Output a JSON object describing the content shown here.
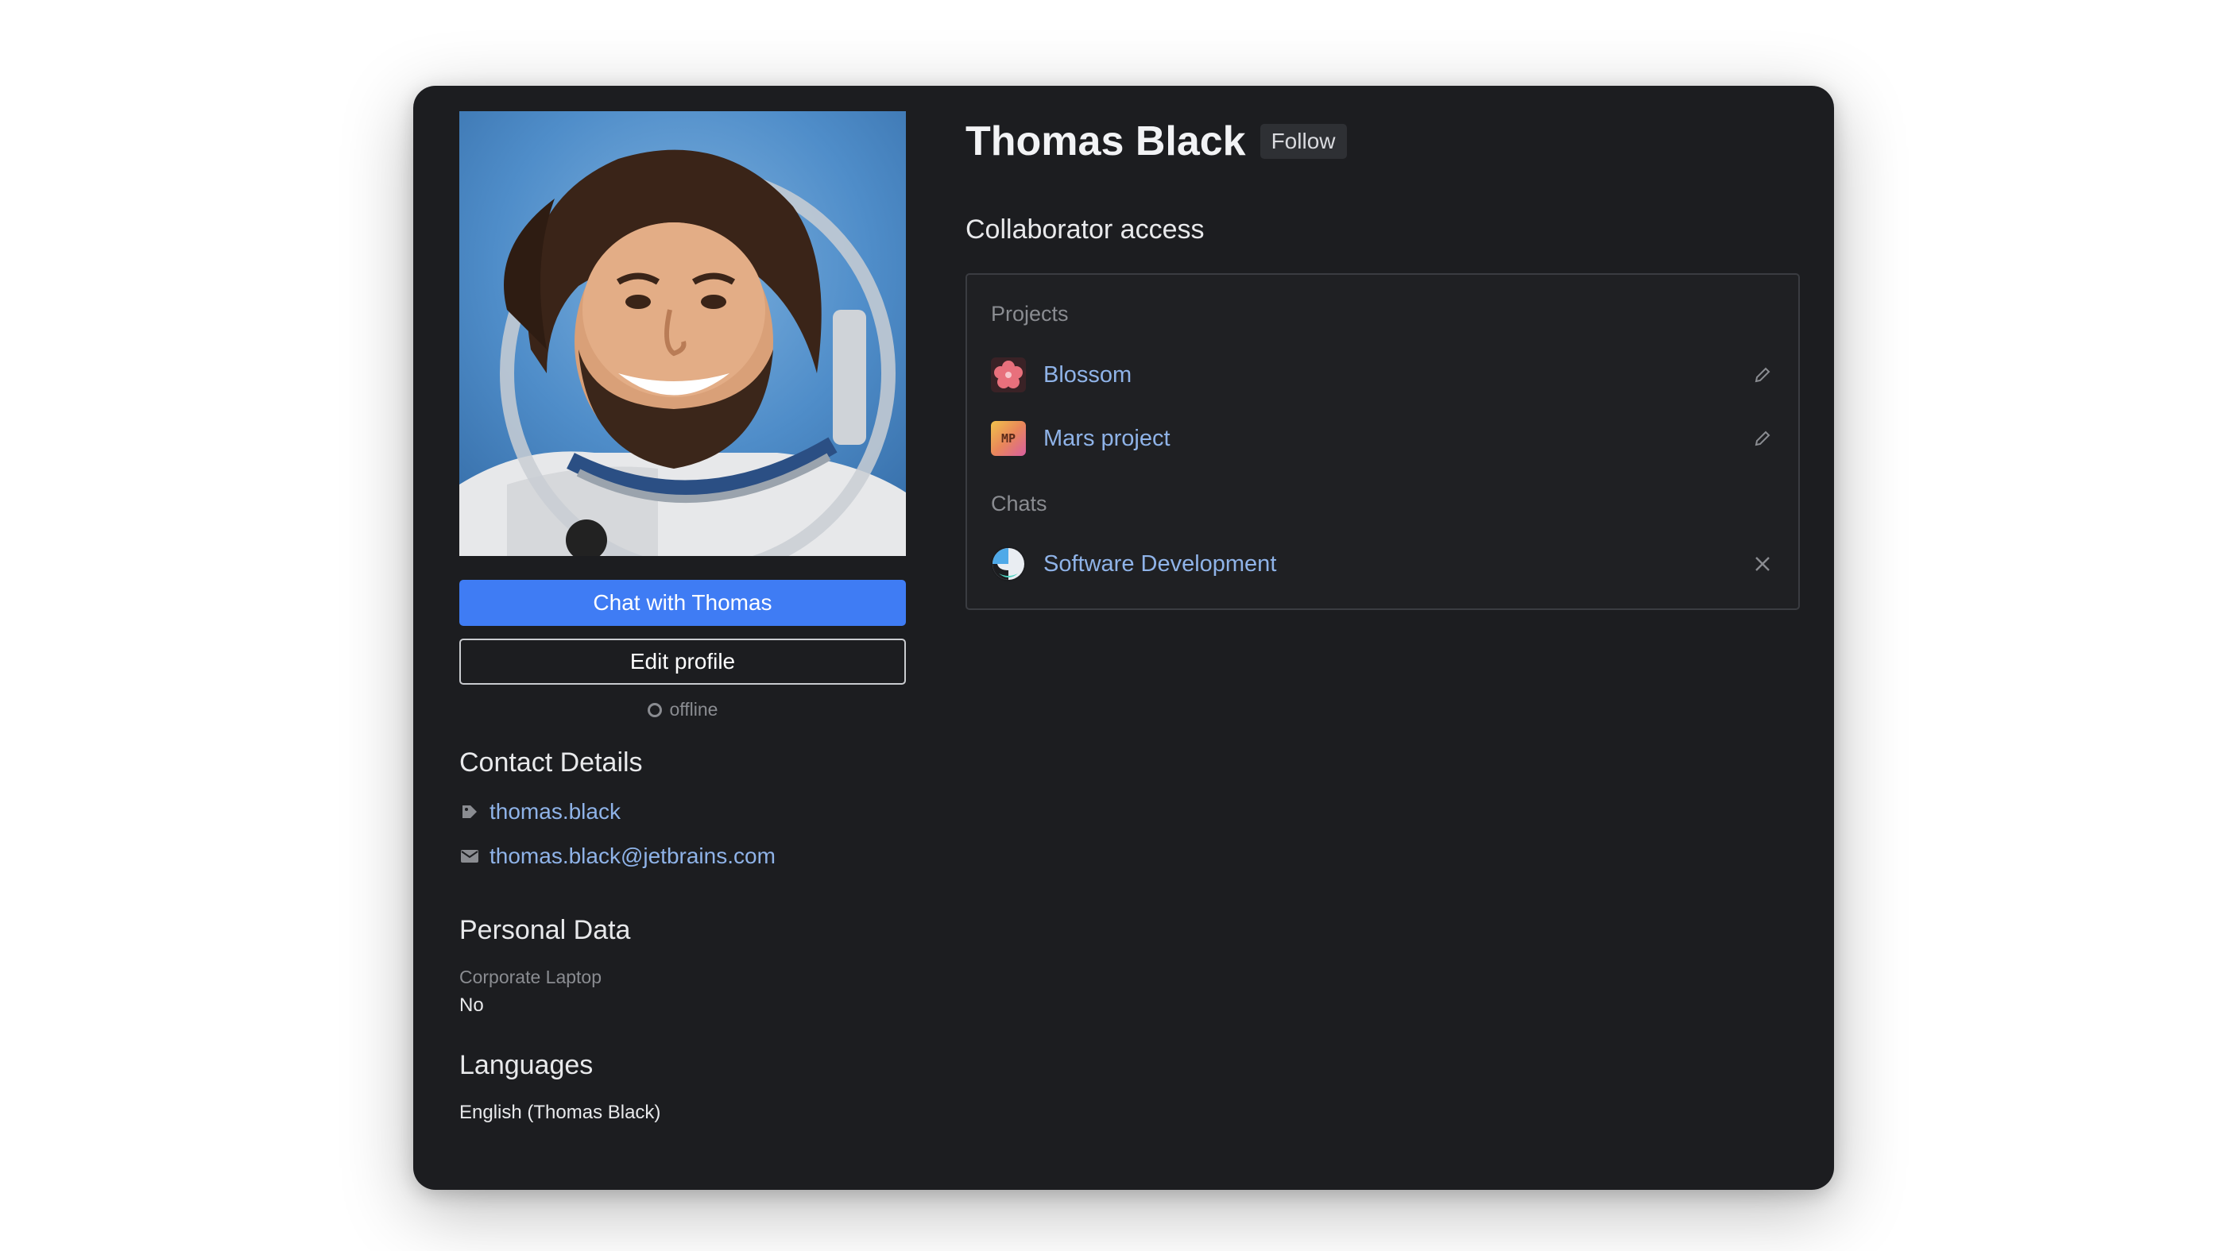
{
  "profile": {
    "name": "Thomas Black",
    "follow_label": "Follow",
    "chat_button": "Chat with Thomas",
    "edit_button": "Edit profile",
    "status": "offline"
  },
  "contact": {
    "title": "Contact Details",
    "username": "thomas.black",
    "email_user": "thomas.black",
    "email_domain": "@jetbrains.com"
  },
  "personal": {
    "title": "Personal Data",
    "laptop_label": "Corporate Laptop",
    "laptop_value": "No"
  },
  "languages": {
    "title": "Languages",
    "value": "English (Thomas Black)"
  },
  "access": {
    "title": "Collaborator access",
    "projects_label": "Projects",
    "projects": [
      {
        "name": "Blossom",
        "icon": "flower-icon",
        "action": "edit-icon"
      },
      {
        "name": "Mars project",
        "icon": "mp-badge",
        "badge_text": "MP",
        "action": "edit-icon"
      }
    ],
    "chats_label": "Chats",
    "chats": [
      {
        "name": "Software Development",
        "icon": "globe-icon",
        "action": "close-icon"
      }
    ]
  },
  "colors": {
    "accent": "#3f7cf4",
    "link": "#8fb3e8",
    "card_bg": "#1c1d20"
  }
}
